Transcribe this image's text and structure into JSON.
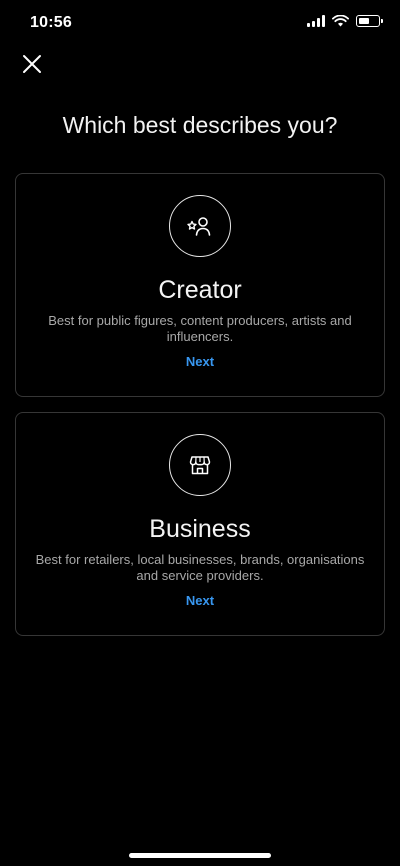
{
  "status_bar": {
    "time": "10:56",
    "icons": [
      "cellular-signal-icon",
      "wifi-icon",
      "battery-icon"
    ]
  },
  "header": {
    "close_icon": "close-icon",
    "title": "Which best describes you?"
  },
  "options": [
    {
      "icon": "creator-star-person-icon",
      "title": "Creator",
      "description": "Best for public figures, content producers, artists and influencers.",
      "action_label": "Next"
    },
    {
      "icon": "storefront-icon",
      "title": "Business",
      "description": "Best for retailers, local businesses, brands, organisations and service providers.",
      "action_label": "Next"
    }
  ],
  "colors": {
    "background": "#000000",
    "card_border": "#363636",
    "accent_link": "#3897f0",
    "secondary_text": "#a8a8a8"
  }
}
